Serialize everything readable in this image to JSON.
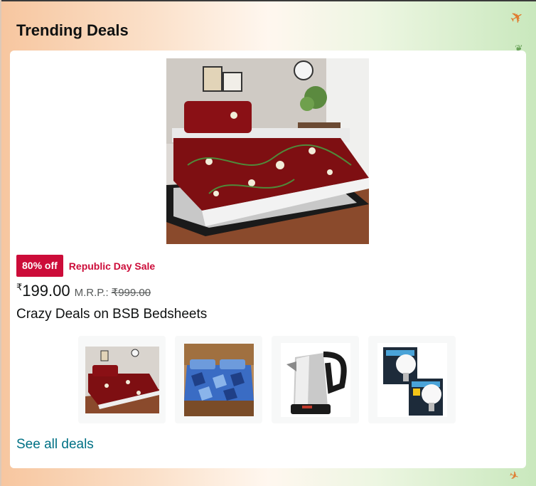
{
  "section": {
    "title": "Trending Deals"
  },
  "deal": {
    "discount_badge": "80% off",
    "event_label": "Republic Day Sale",
    "currency_symbol": "₹",
    "price": "199.00",
    "mrp_label": "M.R.P.:",
    "mrp_value": "₹999.00",
    "title": "Crazy Deals on BSB Bedsheets"
  },
  "thumbnails": [
    {
      "name": "maroon floral bedsheet"
    },
    {
      "name": "blue geometric bedsheet"
    },
    {
      "name": "steel electric kettle"
    },
    {
      "name": "9W LED bulb pack"
    }
  ],
  "link": {
    "see_all": "See all deals"
  },
  "colors": {
    "badge": "#cc0c39",
    "link": "#007185",
    "text": "#0f1111"
  }
}
